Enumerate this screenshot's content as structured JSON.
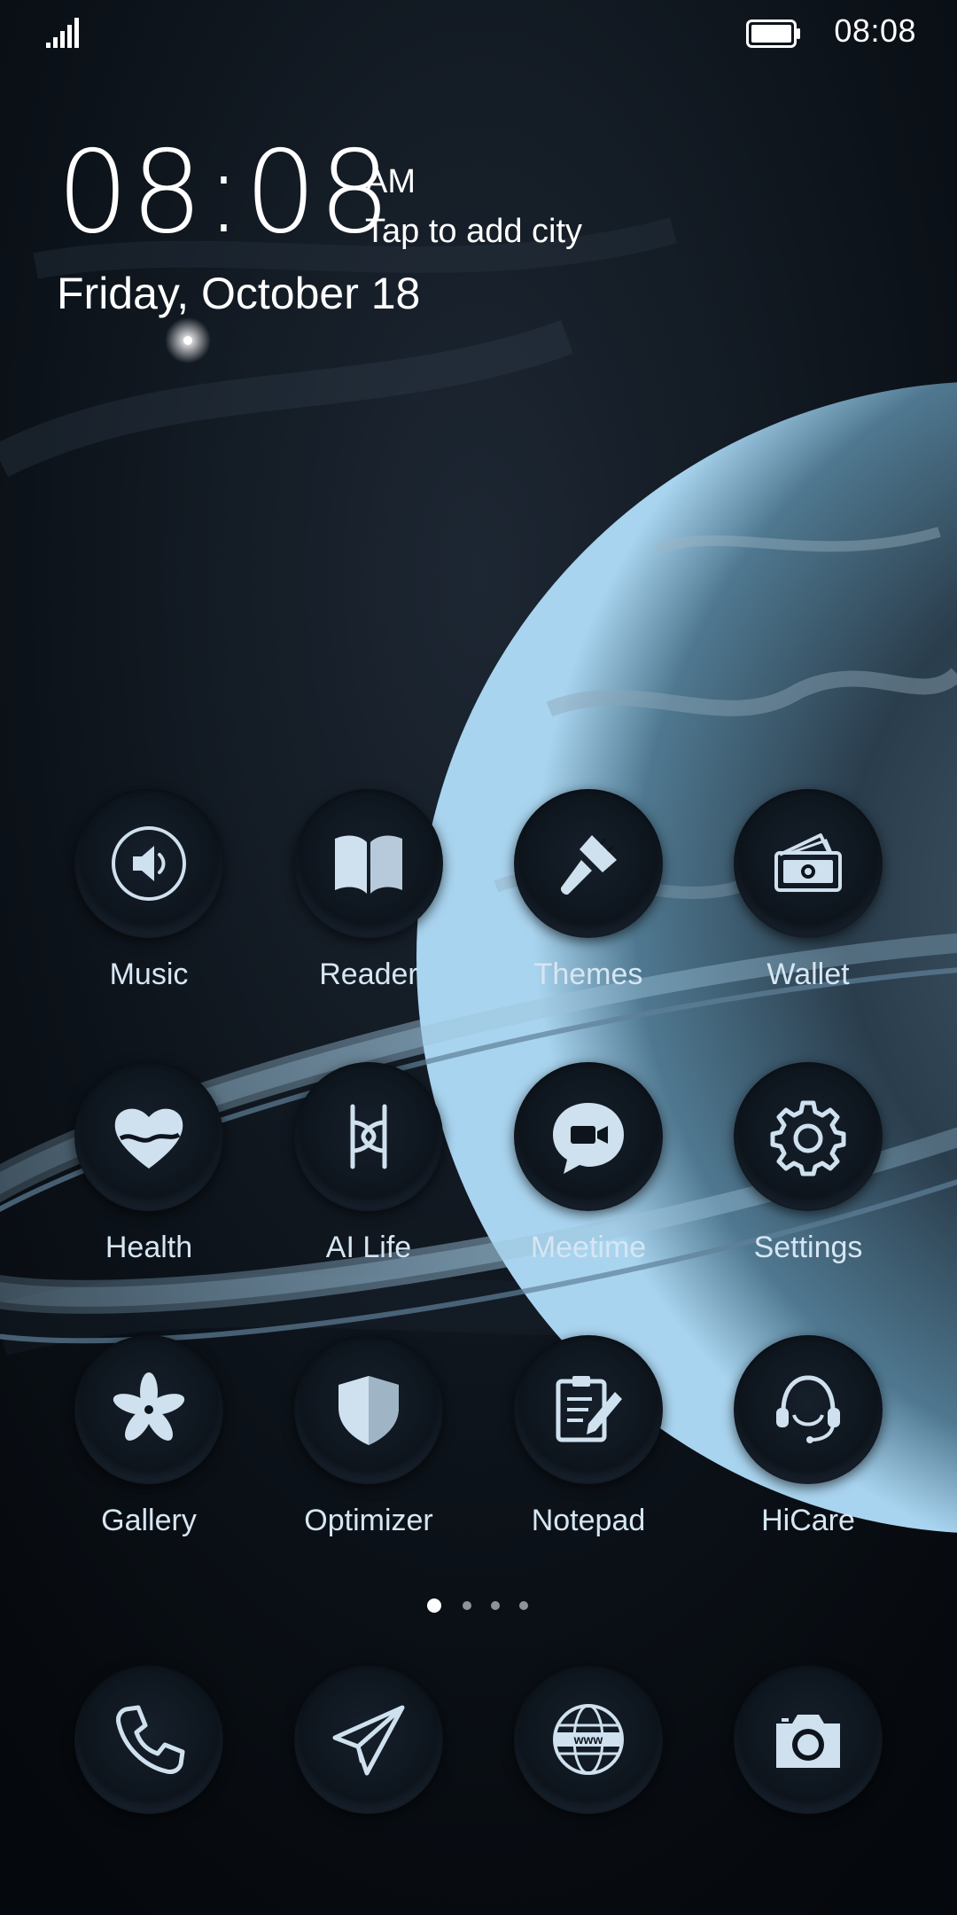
{
  "status_bar": {
    "time": "08:08",
    "signal_icon": "signal-bars-icon",
    "battery_icon": "battery-full-icon"
  },
  "clock_widget": {
    "time": "08:08",
    "ampm": "AM",
    "city_prompt": "Tap to add city",
    "date": "Friday, October 18"
  },
  "apps": [
    {
      "label": "Music",
      "icon": "speaker-icon"
    },
    {
      "label": "Reader",
      "icon": "book-icon"
    },
    {
      "label": "Themes",
      "icon": "paintbrush-icon"
    },
    {
      "label": "Wallet",
      "icon": "wallet-icon"
    },
    {
      "label": "Health",
      "icon": "heart-icon"
    },
    {
      "label": "AI Life",
      "icon": "ai-life-icon"
    },
    {
      "label": "Meetime",
      "icon": "video-chat-icon"
    },
    {
      "label": "Settings",
      "icon": "gear-icon"
    },
    {
      "label": "Gallery",
      "icon": "flower-icon"
    },
    {
      "label": "Optimizer",
      "icon": "shield-icon"
    },
    {
      "label": "Notepad",
      "icon": "notepad-icon"
    },
    {
      "label": "HiCare",
      "icon": "headset-icon"
    }
  ],
  "page_indicator": {
    "pages": 4,
    "current": 1
  },
  "dock": [
    {
      "name": "phone",
      "icon": "phone-icon"
    },
    {
      "name": "messaging",
      "icon": "paper-plane-icon"
    },
    {
      "name": "browser",
      "icon": "globe-www-icon"
    },
    {
      "name": "camera",
      "icon": "camera-icon"
    }
  ],
  "colors": {
    "icon_fill": "#cfe0ee",
    "label_text": "#d6e6f2",
    "background": "#0a0f16"
  }
}
